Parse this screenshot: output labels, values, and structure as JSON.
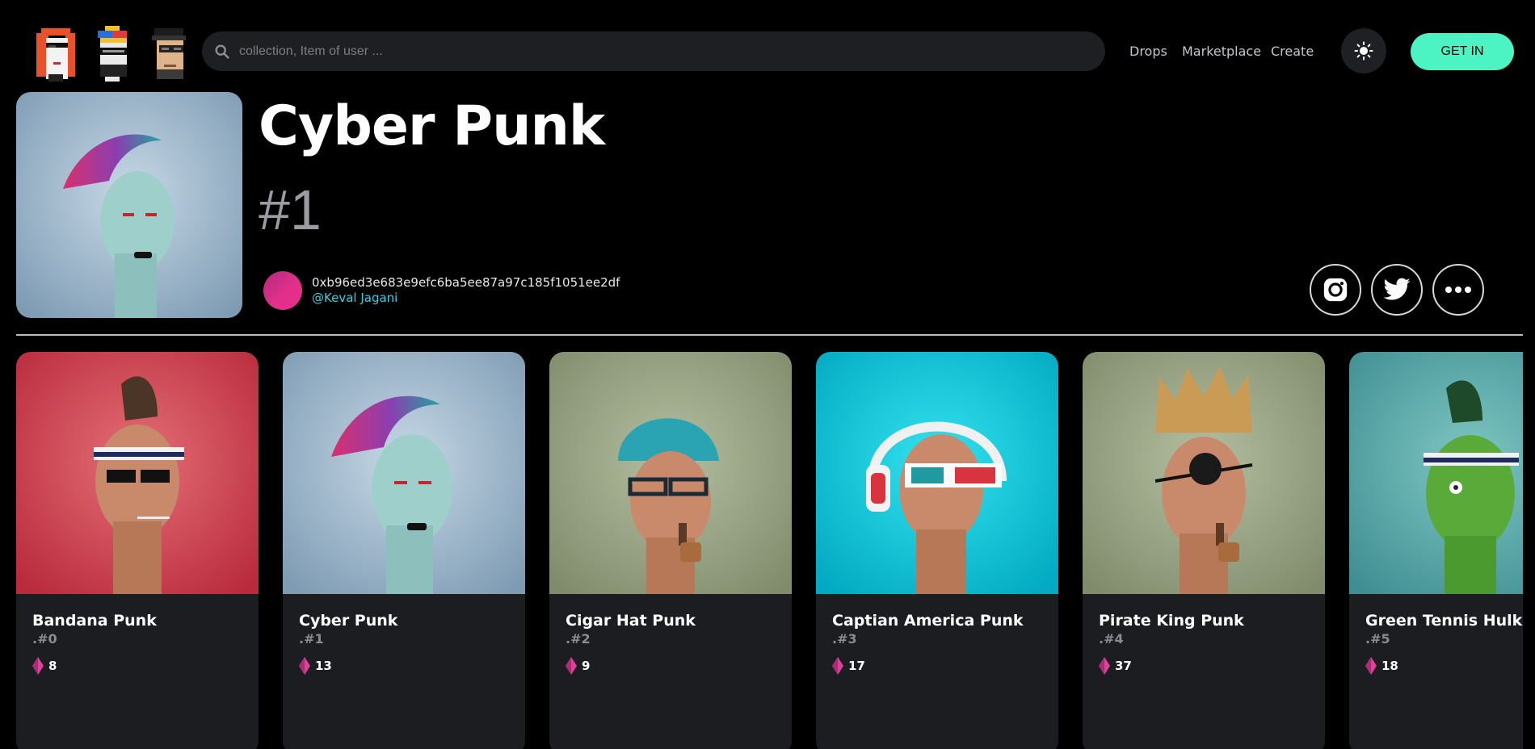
{
  "header": {
    "search_placeholder": "collection, Item of user ...",
    "nav": [
      "Drops",
      "Marketplace",
      "Create"
    ],
    "cta": "GET IN"
  },
  "hero": {
    "title": "Cyber Punk",
    "id": "#1",
    "owner_address": "0xb96ed3e683e9efc6ba5ee87a97c185f1051ee2df",
    "owner_name": "@Keval Jagani"
  },
  "cards": [
    {
      "name": "Bandana Punk",
      "number": ".#0",
      "price": "8"
    },
    {
      "name": "Cyber Punk",
      "number": ".#1",
      "price": "13"
    },
    {
      "name": "Cigar Hat Punk",
      "number": ".#2",
      "price": "9"
    },
    {
      "name": "Captian America Punk",
      "number": ".#3",
      "price": "17"
    },
    {
      "name": "Pirate King Punk",
      "number": ".#4",
      "price": "37"
    },
    {
      "name": "Green Tennis Hulk Punk",
      "number": ".#5",
      "price": "18"
    }
  ],
  "colors": {
    "accent": "#4cf3c3",
    "owner_link": "#2fd2e8",
    "card_bg": "#1c1d20",
    "eth_icon": "#e0409a"
  },
  "icons": [
    "search-icon",
    "sun-icon",
    "instagram-icon",
    "twitter-icon",
    "more-icon",
    "eth-icon"
  ]
}
